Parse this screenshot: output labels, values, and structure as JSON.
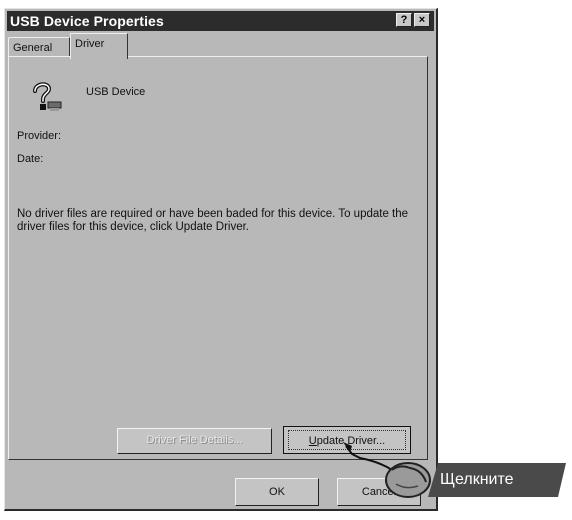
{
  "window": {
    "title": "USB Device Properties",
    "help_btn": "?",
    "close_btn": "×"
  },
  "tabs": [
    {
      "label": "General",
      "active": false
    },
    {
      "label": "Driver",
      "active": true
    }
  ],
  "device": {
    "name": "USB Device",
    "icon": "unknown-device-question-icon"
  },
  "fields": {
    "provider_label": "Provider:",
    "date_label": "Date:"
  },
  "message": "No driver files are required or have been baded for this device. To update the driver files for this device, click Update Driver.",
  "buttons": {
    "driver_details": "Driver File Details...",
    "update_driver_u": "U",
    "update_driver_rest": "pdate Driver...",
    "ok": "OK",
    "cancel": "Cancel"
  },
  "callout": {
    "text": "Щелкните",
    "icon": "pointing-hand-icon"
  }
}
